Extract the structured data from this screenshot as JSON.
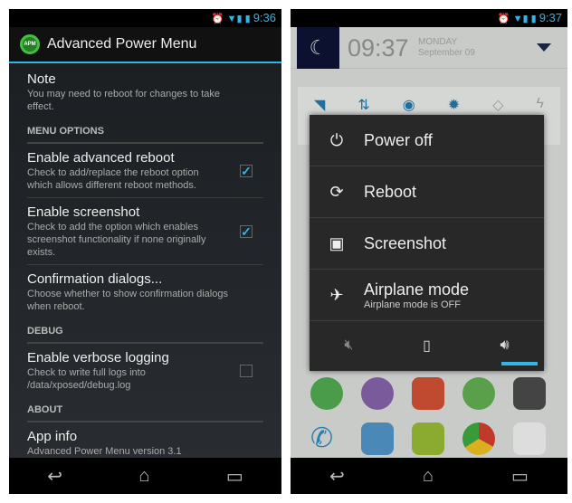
{
  "left": {
    "status": {
      "time": "9:36"
    },
    "app_title": "Advanced Power Menu",
    "logo_text": "APM",
    "note": {
      "title": "Note",
      "summary": "You may need to reboot for changes to take effect."
    },
    "categories": [
      "MENU OPTIONS",
      "DEBUG",
      "ABOUT"
    ],
    "prefs": [
      {
        "title": "Enable advanced reboot",
        "summary": "Check to add/replace the reboot option which allows different reboot methods.",
        "checked": true
      },
      {
        "title": "Enable screenshot",
        "summary": "Check to add the option which enables screenshot functionality if none originally exists.",
        "checked": true
      },
      {
        "title": "Confirmation dialogs...",
        "summary": "Choose whether to show confirmation dialogs when reboot."
      },
      {
        "title": "Enable verbose logging",
        "summary": "Check to write full logs into /data/xposed/debug.log",
        "checked": false
      },
      {
        "title": "App info",
        "summary": "Advanced Power Menu version 3.1"
      }
    ]
  },
  "right": {
    "status": {
      "time": "9:37"
    },
    "clock": "09:37",
    "day": "MONDAY",
    "date": "September 09",
    "menu": [
      {
        "label": "Power off",
        "icon": "power-icon"
      },
      {
        "label": "Reboot",
        "icon": "reboot-icon"
      },
      {
        "label": "Screenshot",
        "icon": "image-icon"
      },
      {
        "label": "Airplane mode",
        "sub": "Airplane mode is OFF",
        "icon": "airplane-icon"
      }
    ],
    "sound_modes": [
      "silent",
      "vibrate",
      "sound"
    ],
    "selected_sound_mode": "sound",
    "accent": "#33b5e5"
  }
}
